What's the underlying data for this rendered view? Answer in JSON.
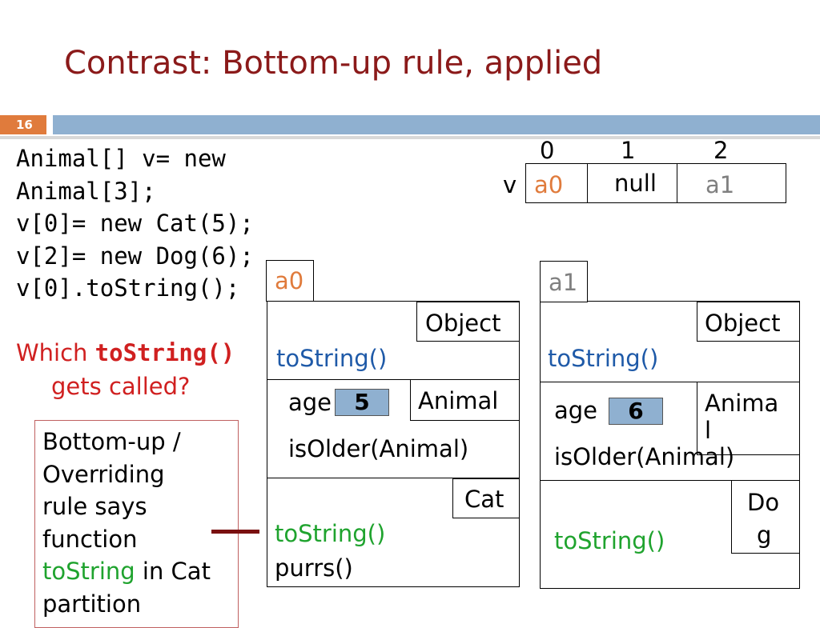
{
  "slide": {
    "title": "Contrast:  Bottom-up rule, applied",
    "number": "16"
  },
  "code": {
    "lines": [
      "Animal[] v= new",
      "Animal[3];",
      "v[0]= new Cat(5);",
      "v[2]= new Dog(6);",
      "v[0].toString();"
    ]
  },
  "question": {
    "prefix": "Which ",
    "method": "toString()",
    "suffix": "gets called?"
  },
  "note": {
    "line1": "Bottom-up /",
    "line2": "Overriding",
    "line3": "rule says",
    "line4": "function",
    "line5_method": "toString",
    "line5_rest": " in Cat",
    "line6": "partition"
  },
  "array": {
    "var_name": "v",
    "indices": [
      "0",
      "1",
      "2"
    ],
    "cells": [
      "a0",
      "null",
      "a1"
    ]
  },
  "cat_object": {
    "name_tab": "a0",
    "object_label": "Object",
    "object_method": "toString()",
    "animal_field": "age",
    "animal_value": "5",
    "animal_label": "Animal",
    "animal_method": "isOlder(Animal)",
    "cat_label": "Cat",
    "cat_method1": "toString()",
    "cat_method2": "purrs()"
  },
  "dog_object": {
    "name_tab": "a1",
    "object_label": "Object",
    "object_method": "toString()",
    "animal_field": "age",
    "animal_value": "6",
    "animal_label_1": "Anima",
    "animal_label_2": "l",
    "animal_method": "isOlder(Animal)",
    "dog_label_1": "Do",
    "dog_label_2": "g",
    "dog_method": "toString()"
  }
}
